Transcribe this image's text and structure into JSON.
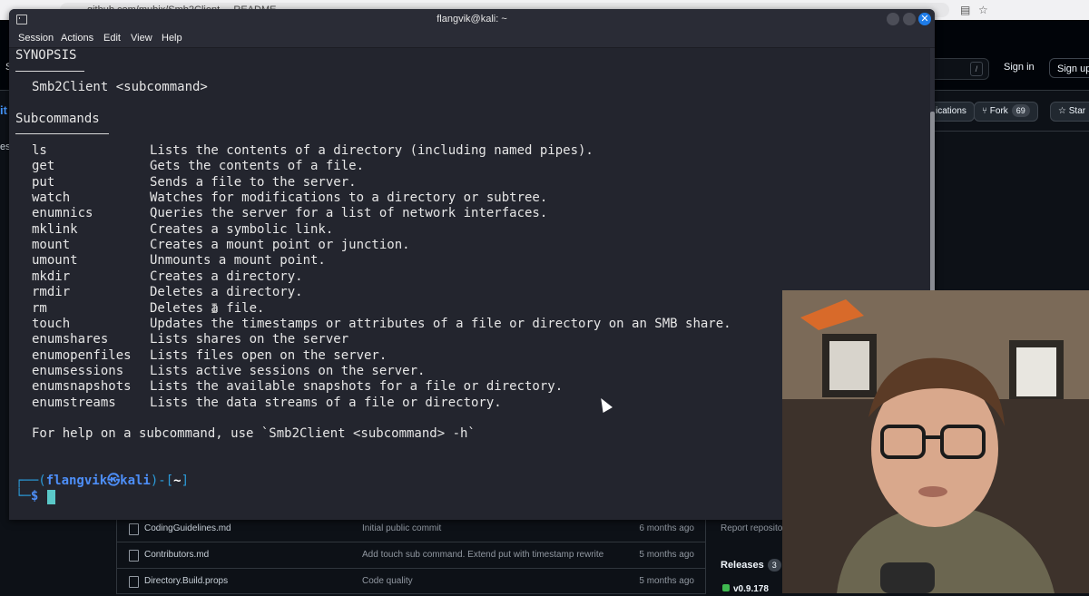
{
  "browser": {
    "address": "github.com/mubix/Smb2Client ... README"
  },
  "github": {
    "left_s": "S",
    "left_it": "it",
    "left_es": "es",
    "signin": "Sign in",
    "signup": "Sign up",
    "search_key": "/",
    "notifications": "ications",
    "fork_label": "Fork",
    "fork_count": "69",
    "star_label": "Star",
    "files": [
      {
        "name": "CodingGuidelines.md",
        "message": "Initial public commit",
        "time": "6 months ago"
      },
      {
        "name": "Contributors.md",
        "message": "Add touch sub command. Extend put with timestamp rewrite",
        "time": "5 months ago"
      },
      {
        "name": "Directory.Build.props",
        "message": "Code quality",
        "time": "5 months ago"
      }
    ],
    "report": "Report reposito",
    "releases_label": "Releases",
    "releases_count": "3",
    "version": "v0.9.178"
  },
  "terminal": {
    "title": "flangvik@kali: ~",
    "menu": [
      "Session",
      "Actions",
      "Edit",
      "View",
      "Help"
    ],
    "synopsis_heading": "SYNOPSIS",
    "usage": "Smb2Client <subcommand>",
    "subcommands_heading": "Subcommands",
    "subcommands": [
      {
        "cmd": "ls",
        "desc": "Lists the contents of a directory (including named pipes)."
      },
      {
        "cmd": "get",
        "desc": "Gets the contents of a file."
      },
      {
        "cmd": "put",
        "desc": "Sends a file to the server."
      },
      {
        "cmd": "watch",
        "desc": "Watches for modifications to a directory or subtree."
      },
      {
        "cmd": "enumnics",
        "desc": "Queries the server for a list of network interfaces."
      },
      {
        "cmd": "mklink",
        "desc": "Creates a symbolic link."
      },
      {
        "cmd": "mount",
        "desc": "Creates a mount point or junction."
      },
      {
        "cmd": "umount",
        "desc": "Unmounts a mount point."
      },
      {
        "cmd": "mkdir",
        "desc": "Creates a directory."
      },
      {
        "cmd": "rmdir",
        "desc": "Deletes a directory."
      },
      {
        "cmd": "rm",
        "desc": "Deletes a file."
      },
      {
        "cmd": "touch",
        "desc": "Updates the timestamps or attributes of a file or directory on an SMB share."
      },
      {
        "cmd": "enumshares",
        "desc": "Lists shares on the server"
      },
      {
        "cmd": "enumopenfiles",
        "desc": "Lists files open on the server."
      },
      {
        "cmd": "enumsessions",
        "desc": "Lists active sessions on the server."
      },
      {
        "cmd": "enumsnapshots",
        "desc": "Lists the available snapshots for a file or directory."
      },
      {
        "cmd": "enumstreams",
        "desc": "Lists the data streams of a file or directory."
      }
    ],
    "help_line": "For help on a subcommand, use `Smb2Client <subcommand> -h`",
    "prompt": {
      "open": "┌──(",
      "user": "flangvik㉿kali",
      "mid": ")-[",
      "path": "~",
      "close": "]",
      "line2": "└─",
      "dollar": "$"
    }
  },
  "colors": {
    "terminal_bg": "#23252e",
    "prompt_blue": "#4d8ef7",
    "close_button": "#1e7ce8",
    "github_bg": "#0d1117"
  }
}
